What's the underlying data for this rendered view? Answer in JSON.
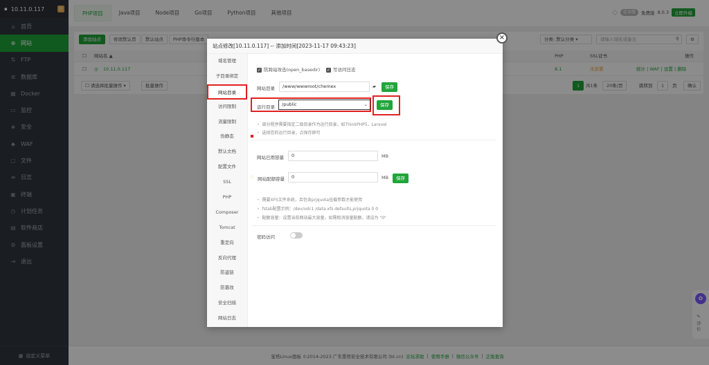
{
  "sidebar": {
    "ip": "10.11.0.117",
    "badge": "0",
    "items": [
      {
        "label": "首页",
        "icon": "home-icon",
        "glyph": "⌂"
      },
      {
        "label": "网站",
        "icon": "globe-icon",
        "glyph": "⊕"
      },
      {
        "label": "FTP",
        "icon": "ftp-icon",
        "glyph": "⇅"
      },
      {
        "label": "数据库",
        "icon": "database-icon",
        "glyph": "≣"
      },
      {
        "label": "Docker",
        "icon": "docker-icon",
        "glyph": "▦"
      },
      {
        "label": "监控",
        "icon": "monitor-icon",
        "glyph": "▭"
      },
      {
        "label": "安全",
        "icon": "shield-icon",
        "glyph": "◈"
      },
      {
        "label": "WAF",
        "icon": "waf-icon",
        "glyph": "◆"
      },
      {
        "label": "文件",
        "icon": "folder-icon",
        "glyph": "▢"
      },
      {
        "label": "日志",
        "icon": "log-icon",
        "glyph": "≡"
      },
      {
        "label": "终端",
        "icon": "terminal-icon",
        "glyph": "▣"
      },
      {
        "label": "计划任务",
        "icon": "clock-icon",
        "glyph": "◷"
      },
      {
        "label": "软件商店",
        "icon": "store-icon",
        "glyph": "▤"
      },
      {
        "label": "面板设置",
        "icon": "gear-icon",
        "glyph": "⚙"
      },
      {
        "label": "退出",
        "icon": "logout-icon",
        "glyph": "⇥"
      }
    ],
    "footer": "自定义菜单"
  },
  "topbar": {
    "tabs": [
      "PHP项目",
      "Java项目",
      "Node项目",
      "Go项目",
      "Python项目",
      "其他项目"
    ],
    "enterprise": "企业版",
    "free": "免费版",
    "version": "8.0.3",
    "upgrade": "立即升级"
  },
  "panel": {
    "buttons": [
      "添加站点",
      "修改默认页",
      "默认站点",
      "PHP命令行版本"
    ],
    "category": "分类: 默认分类",
    "search_placeholder": "请输入域名或备注",
    "col_name": "网站名 ▲",
    "col_php": "PHP",
    "col_ssl": "SSL证书",
    "col_action": "操作",
    "row_site": "10.11.0.117",
    "row_php": "8.1",
    "row_ssl": "未部署",
    "row_actions": "统计 | WAF | 设置 | 删除",
    "batch": "请选择批量操作",
    "batch_btn": "批量操作",
    "pager_page": "1",
    "pager_total": "共1条",
    "pager_size": "20条/页",
    "pager_jump": "跳转到",
    "pager_input": "1",
    "pager_unit": "页",
    "pager_ok": "确认"
  },
  "footer": {
    "copyright": "宝塔Linux面板 ©2014-2023 广东堡塔安全技术有限公司 (bt.cn)",
    "links": [
      "论坛求助",
      "使用手册",
      "微信公众号",
      "正版查询"
    ]
  },
  "modal": {
    "title": "站点修改[10.11.0.117] -- 添加时间[2023-11-17 09:43:23]",
    "nav": [
      "域名管理",
      "子目录绑定",
      "网站目录",
      "访问限制",
      "流量限制",
      "伪静态",
      "默认文档",
      "配置文件",
      "SSL",
      "PHP",
      "Composer",
      "Tomcat",
      "重定向",
      "反向代理",
      "防盗链",
      "防篡改",
      "安全扫描",
      "网站日志"
    ],
    "anti_xss": "防跨站攻击(open_basedir)",
    "write_log": "写访问日志",
    "site_dir_label": "网站目录",
    "site_dir_value": "/www/wwwroot/chemex",
    "save": "保存",
    "run_dir_label": "运行目录",
    "run_dir_value": "/public",
    "tips1": [
      "部分程序需要指定二级目录作为运行目录，如ThinkPHP5，Laravel",
      "选择您的运行目录，点保存即可"
    ],
    "used_label": "网站已用容量",
    "used_value": "0",
    "unit": "MB",
    "quota_label": "网站配额容量",
    "quota_value": "0",
    "tips2": [
      "需要XFS文件系统，且包含prjquota挂载参数才能使用",
      "fstab配置示例：/dev/vdc1 /data xfs defaults,prjquota 0 0",
      "配额容量：设置当前网站最大容量，如需取消容量配额，请设为 \"0\""
    ],
    "pwd_access": "密码访问"
  },
  "floating": {
    "review": "评价"
  }
}
